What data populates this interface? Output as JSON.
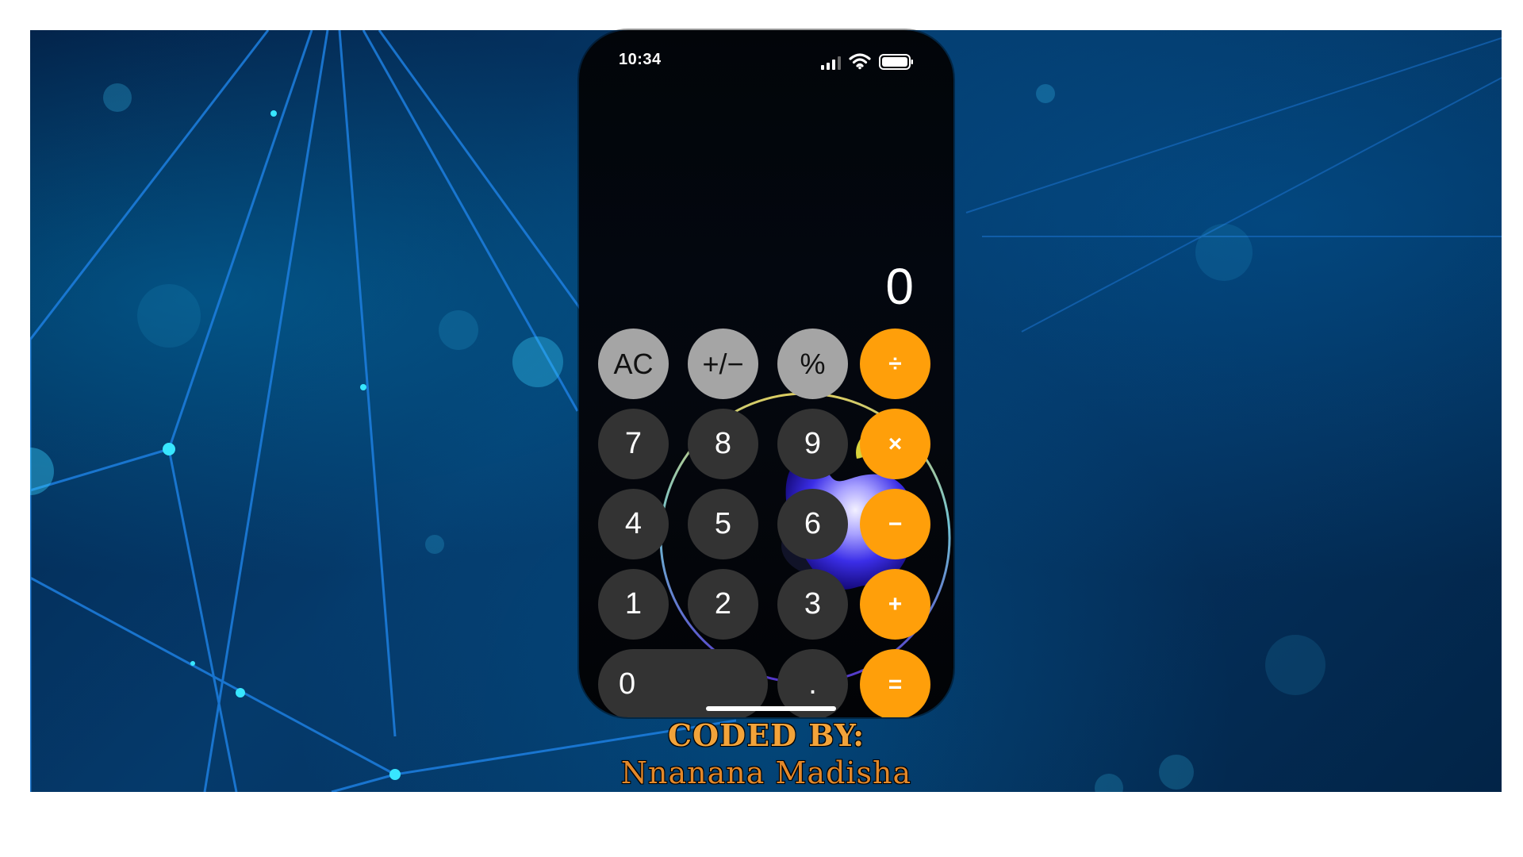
{
  "status_bar": {
    "time": "10:34"
  },
  "display": {
    "value": "0"
  },
  "keys": {
    "ac": "AC",
    "sign": "+/−",
    "percent": "%",
    "divide": "÷",
    "multiply": "×",
    "minus": "−",
    "plus": "+",
    "equals": "=",
    "seven": "7",
    "eight": "8",
    "nine": "9",
    "four": "4",
    "five": "5",
    "six": "6",
    "one": "1",
    "two": "2",
    "three": "3",
    "zero": "0",
    "decimal": "."
  },
  "credit": {
    "title": "CODED BY:",
    "name": "Nnanana Madisha"
  },
  "colors": {
    "operator": "#ff9f0a",
    "function": "#a5a5a5",
    "number": "#333333",
    "background": "#053a6b"
  }
}
